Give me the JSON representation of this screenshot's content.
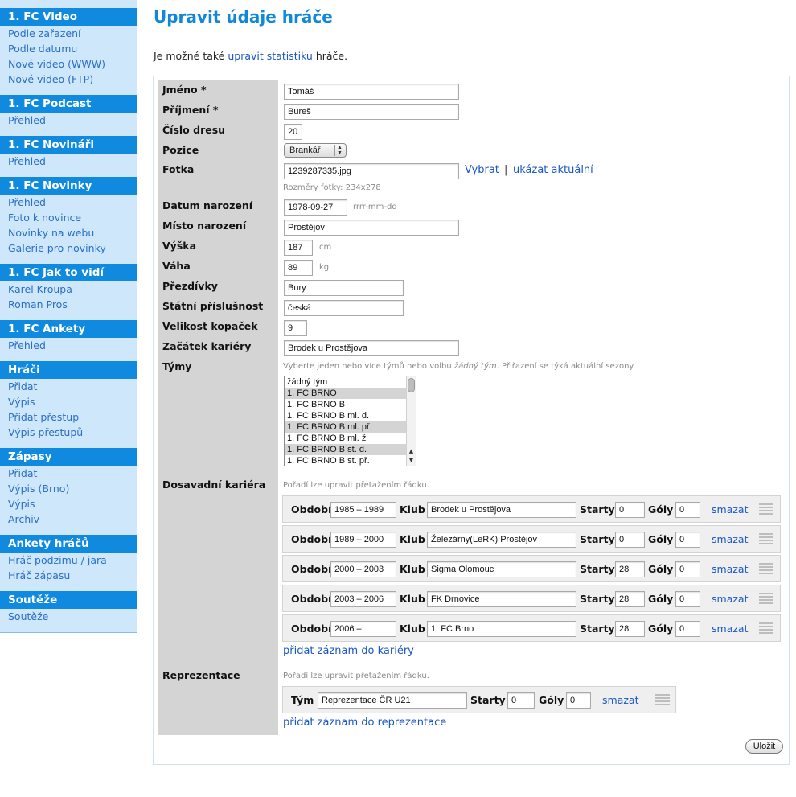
{
  "sidebar": {
    "sections": [
      {
        "title": "1. FC Video",
        "items": [
          "Podle zařazení",
          "Podle datumu",
          "Nové video (WWW)",
          "Nové video (FTP)"
        ]
      },
      {
        "title": "1. FC Podcast",
        "items": [
          "Přehled"
        ]
      },
      {
        "title": "1. FC Novináři",
        "items": [
          "Přehled"
        ]
      },
      {
        "title": "1. FC Novinky",
        "items": [
          "Přehled",
          "Foto k novince",
          "Novinky na webu",
          "Galerie pro novinky"
        ]
      },
      {
        "title": "1. FC Jak to vidí",
        "items": [
          "Karel Kroupa",
          "Roman Pros"
        ]
      },
      {
        "title": "1. FC Ankety",
        "items": [
          "Přehled"
        ]
      },
      {
        "title": "Hráči",
        "items": [
          "Přidat",
          "Výpis",
          "Přidat přestup",
          "Výpis přestupů"
        ]
      },
      {
        "title": "Zápasy",
        "items": [
          "Přidat",
          "Výpis (Brno)",
          "Výpis",
          "Archiv"
        ]
      },
      {
        "title": "Ankety hráčů",
        "items": [
          "Hráč podzimu / jara",
          "Hráč zápasu"
        ]
      },
      {
        "title": "Soutěže",
        "items": [
          "Soutěže"
        ]
      }
    ]
  },
  "page": {
    "title": "Upravit údaje hráče",
    "intro_before": "Je možné také ",
    "intro_link": "upravit statistiku",
    "intro_after": " hráče."
  },
  "form": {
    "labels": {
      "first_name": "Jméno *",
      "last_name": "Příjmení *",
      "jersey": "Číslo dresu",
      "position": "Pozice",
      "photo": "Fotka",
      "birth_date": "Datum narození",
      "birth_place": "Místo narození",
      "height": "Výška",
      "weight": "Váha",
      "nicknames": "Přezdívky",
      "nationality": "Státní příslušnost",
      "shoe_size": "Velikost kopaček",
      "career_start": "Začátek kariéry",
      "teams": "Týmy",
      "career": "Dosavadní kariéra",
      "representation": "Reprezentace"
    },
    "values": {
      "first_name": "Tomáš",
      "last_name": "Bureš",
      "jersey": "20",
      "position": "Brankář",
      "photo": "1239287335.jpg",
      "birth_date": "1978-09-27",
      "birth_place": "Prostějov",
      "height": "187",
      "weight": "89",
      "nicknames": "Bury",
      "nationality": "česká",
      "shoe_size": "9",
      "career_start": "Brodek u Prostějova"
    },
    "photo_choose": "Vybrat",
    "photo_sep": "|",
    "photo_show": "ukázat aktuální",
    "photo_hint": "Rozměry fotky: 234x278",
    "date_hint": "rrrr-mm-dd",
    "height_unit": "cm",
    "weight_unit": "kg",
    "teams_hint_a": "Vyberte jeden nebo více týmů nebo volbu ",
    "teams_hint_em": "žádný tým",
    "teams_hint_b": ". Přiřazení se týká aktuální sezony.",
    "teams": [
      {
        "name": "žádný tým",
        "selected": false
      },
      {
        "name": "1. FC BRNO",
        "selected": true
      },
      {
        "name": "1. FC BRNO B",
        "selected": false
      },
      {
        "name": "1. FC BRNO B ml. d.",
        "selected": false
      },
      {
        "name": "1. FC BRNO B ml. př.",
        "selected": true
      },
      {
        "name": "1. FC BRNO B ml. ž",
        "selected": false
      },
      {
        "name": "1. FC BRNO B st. d.",
        "selected": true
      },
      {
        "name": "1. FC BRNO B st. př.",
        "selected": false
      }
    ],
    "drag_hint": "Pořadí lze upravit přetažením řádku.",
    "career_cols": {
      "period": "Období",
      "club": "Klub",
      "starts": "Starty",
      "goals": "Góly",
      "delete": "smazat"
    },
    "career_rows": [
      {
        "period": "1985 – 1989",
        "club": "Brodek u Prostějova",
        "starts": "0",
        "goals": "0"
      },
      {
        "period": "1989 – 2000",
        "club": "Železárny(LeRK) Prostějov",
        "starts": "0",
        "goals": "0"
      },
      {
        "period": "2000 – 2003",
        "club": "Sigma Olomouc",
        "starts": "28",
        "goals": "0"
      },
      {
        "period": "2003 – 2006",
        "club": "FK Drnovice",
        "starts": "28",
        "goals": "0"
      },
      {
        "period": "2006 –",
        "club": "1. FC Brno",
        "starts": "28",
        "goals": "0"
      }
    ],
    "add_career": "přidat záznam do kariéry",
    "rep_cols": {
      "team": "Tým",
      "starts": "Starty",
      "goals": "Góly",
      "delete": "smazat"
    },
    "rep_rows": [
      {
        "team": "Reprezentace ČR U21",
        "starts": "0",
        "goals": "0"
      }
    ],
    "add_rep": "přidat záznam do reprezentace",
    "save": "Uložit"
  }
}
